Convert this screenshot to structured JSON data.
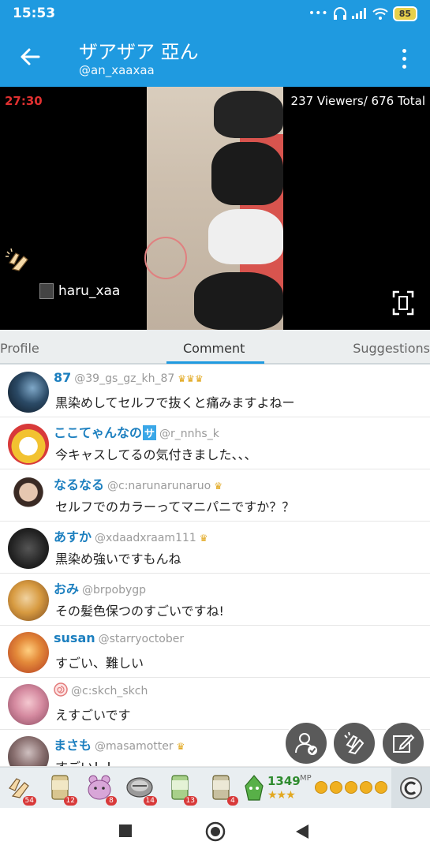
{
  "status_bar": {
    "time": "15:53",
    "icons": [
      "dots-icon",
      "headphones-icon",
      "signal-icon",
      "wifi-icon"
    ],
    "battery": "85"
  },
  "header": {
    "title": "ザアザア 亞ん",
    "handle": "@an_xaaxaa"
  },
  "video": {
    "timer": "27:30",
    "viewers": "237 Viewers/ 676 Total",
    "broadcaster": "haru_xaa"
  },
  "tabs": [
    {
      "label": "Profile",
      "active": false
    },
    {
      "label": "Comment",
      "active": true
    },
    {
      "label": "Suggestions",
      "active": false
    }
  ],
  "comments": [
    {
      "name": "87",
      "handle": "@39_gs_gz_kh_87",
      "badge": "♛♛♛",
      "text": "黒染めしてセルフで抜くと痛みますよねー"
    },
    {
      "name": "ここてゃんなの",
      "name_badge": "サ",
      "handle": "@r_nnhs_k",
      "text": "今キャスしてるの気付きました、、、"
    },
    {
      "name": "なるなる",
      "handle": "@c:narunarunaruo",
      "badge": "♛",
      "text": "セルフでのカラーってマニパニですか？？"
    },
    {
      "name": "あすか",
      "handle": "@xdaadxraam111",
      "badge": "♛",
      "text": "黒染め強いですもんね"
    },
    {
      "name": "おみ",
      "handle": "@brpobygp",
      "text": "その髪色保つのすごいですね!"
    },
    {
      "name": "susan",
      "handle": "@starryoctober",
      "text": "すごい、難しい"
    },
    {
      "name": "",
      "handle": "@c:skch_skch",
      "text": "えすごいです"
    },
    {
      "name": "まさも",
      "handle": "@masamotter",
      "badge": "♛",
      "text": "すごい！！"
    }
  ],
  "gifts": [
    {
      "icon": "clap-gift-icon",
      "count": "54"
    },
    {
      "icon": "tea-gift-icon",
      "count": "12"
    },
    {
      "icon": "bear-gift-icon",
      "count": "8"
    },
    {
      "icon": "can-gift-icon",
      "count": "14"
    },
    {
      "icon": "tea10-gift-icon",
      "count": "13"
    },
    {
      "icon": "tea100-gift-icon",
      "count": "4"
    }
  ],
  "mp": {
    "value": "1349",
    "unit": "MP",
    "stars": "★★★"
  },
  "colors": {
    "brand": "#1f9ae0",
    "name": "#1c7fbf",
    "timer": "#e03030"
  }
}
